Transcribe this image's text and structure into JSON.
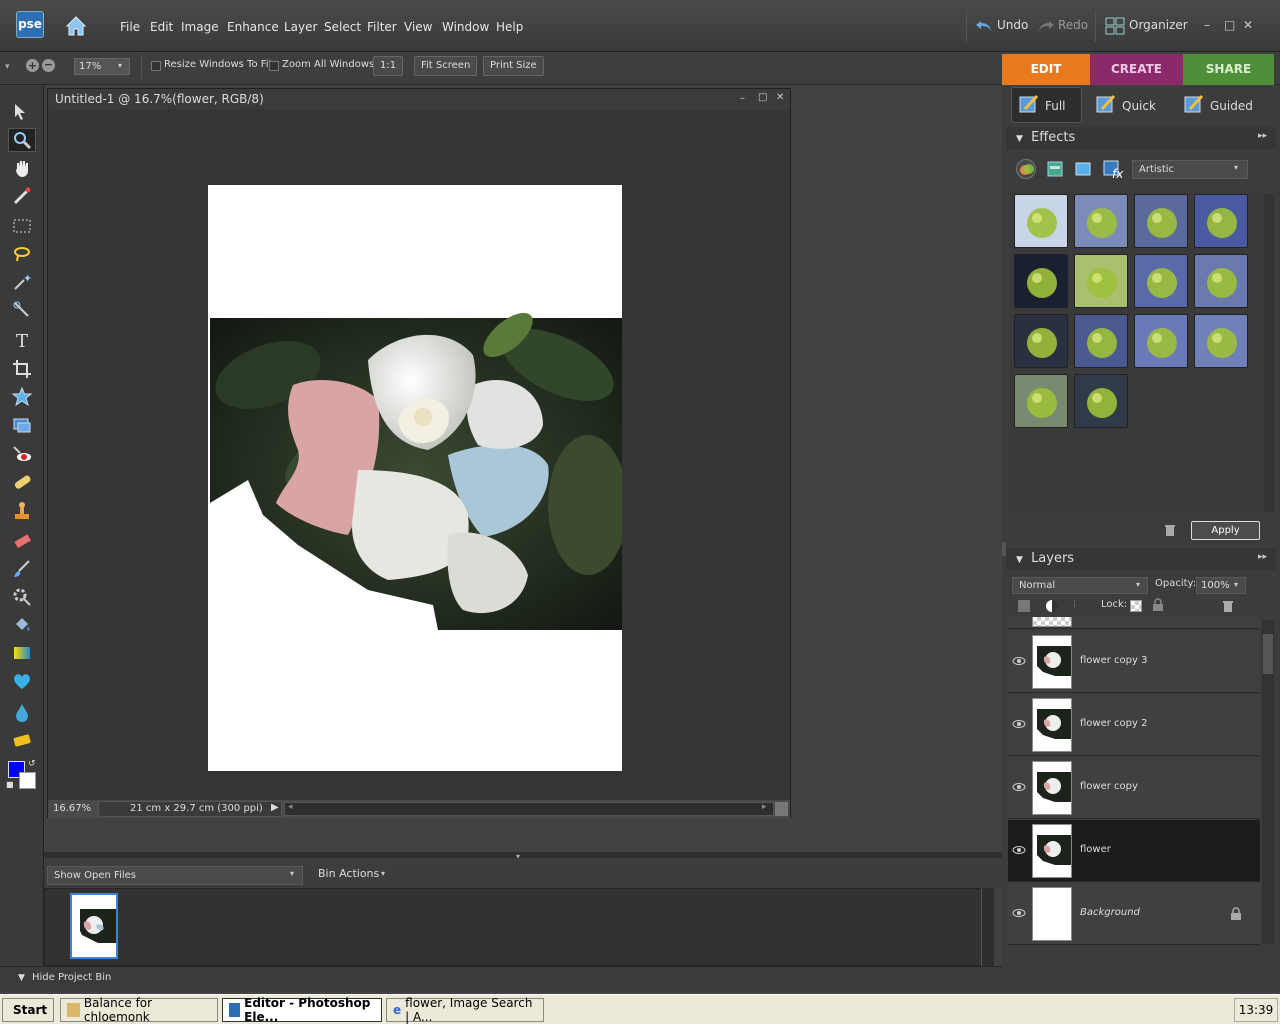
{
  "app": {
    "logo": "pse",
    "title": "Untitled-1 @ 16.7%(flower, RGB/8)"
  },
  "menu": [
    "File",
    "Edit",
    "Image",
    "Enhance",
    "Layer",
    "Select",
    "Filter",
    "View",
    "Window",
    "Help"
  ],
  "topright": {
    "undo": "Undo",
    "redo": "Redo",
    "organizer": "Organizer"
  },
  "options": {
    "zoom": "17%",
    "resize_windows": "Resize Windows To Fit",
    "zoom_all": "Zoom All Windows",
    "one_to_one": "1:1",
    "fit_screen": "Fit Screen",
    "print_size": "Print Size"
  },
  "mode_tabs": {
    "edit": "EDIT",
    "create": "CREATE",
    "share": "SHARE",
    "colors": {
      "edit": "#e8791c",
      "create": "#8a2a6a",
      "share": "#4f8f3a"
    }
  },
  "panel_tabs": {
    "full": "Full",
    "quick": "Quick",
    "guided": "Guided"
  },
  "effects": {
    "header": "Effects",
    "category": "Artistic",
    "apply": "Apply",
    "thumb_count": 14
  },
  "layers": {
    "header": "Layers",
    "blend_mode": "Normal",
    "opacity_label": "Opacity:",
    "opacity": "100%",
    "lock_label": "Lock:",
    "items": [
      {
        "name": "flower copy 3",
        "selected": false
      },
      {
        "name": "flower copy 2",
        "selected": false
      },
      {
        "name": "flower copy",
        "selected": false
      },
      {
        "name": "flower",
        "selected": true
      },
      {
        "name": "Background",
        "selected": false
      }
    ]
  },
  "doc": {
    "zoom": "16.67%",
    "size": "21 cm x 29.7 cm (300 ppi)"
  },
  "bin": {
    "show": "Show Open Files",
    "actions": "Bin Actions",
    "hide": "Hide Project Bin"
  },
  "taskbar": {
    "start": "Start",
    "items": [
      "Balance for chloemonk",
      "Editor - Photoshop Ele...",
      "flower, Image Search | A..."
    ],
    "clock": "13:39"
  },
  "colors": {
    "foreground": "#0000ff",
    "background": "#ffffff"
  }
}
